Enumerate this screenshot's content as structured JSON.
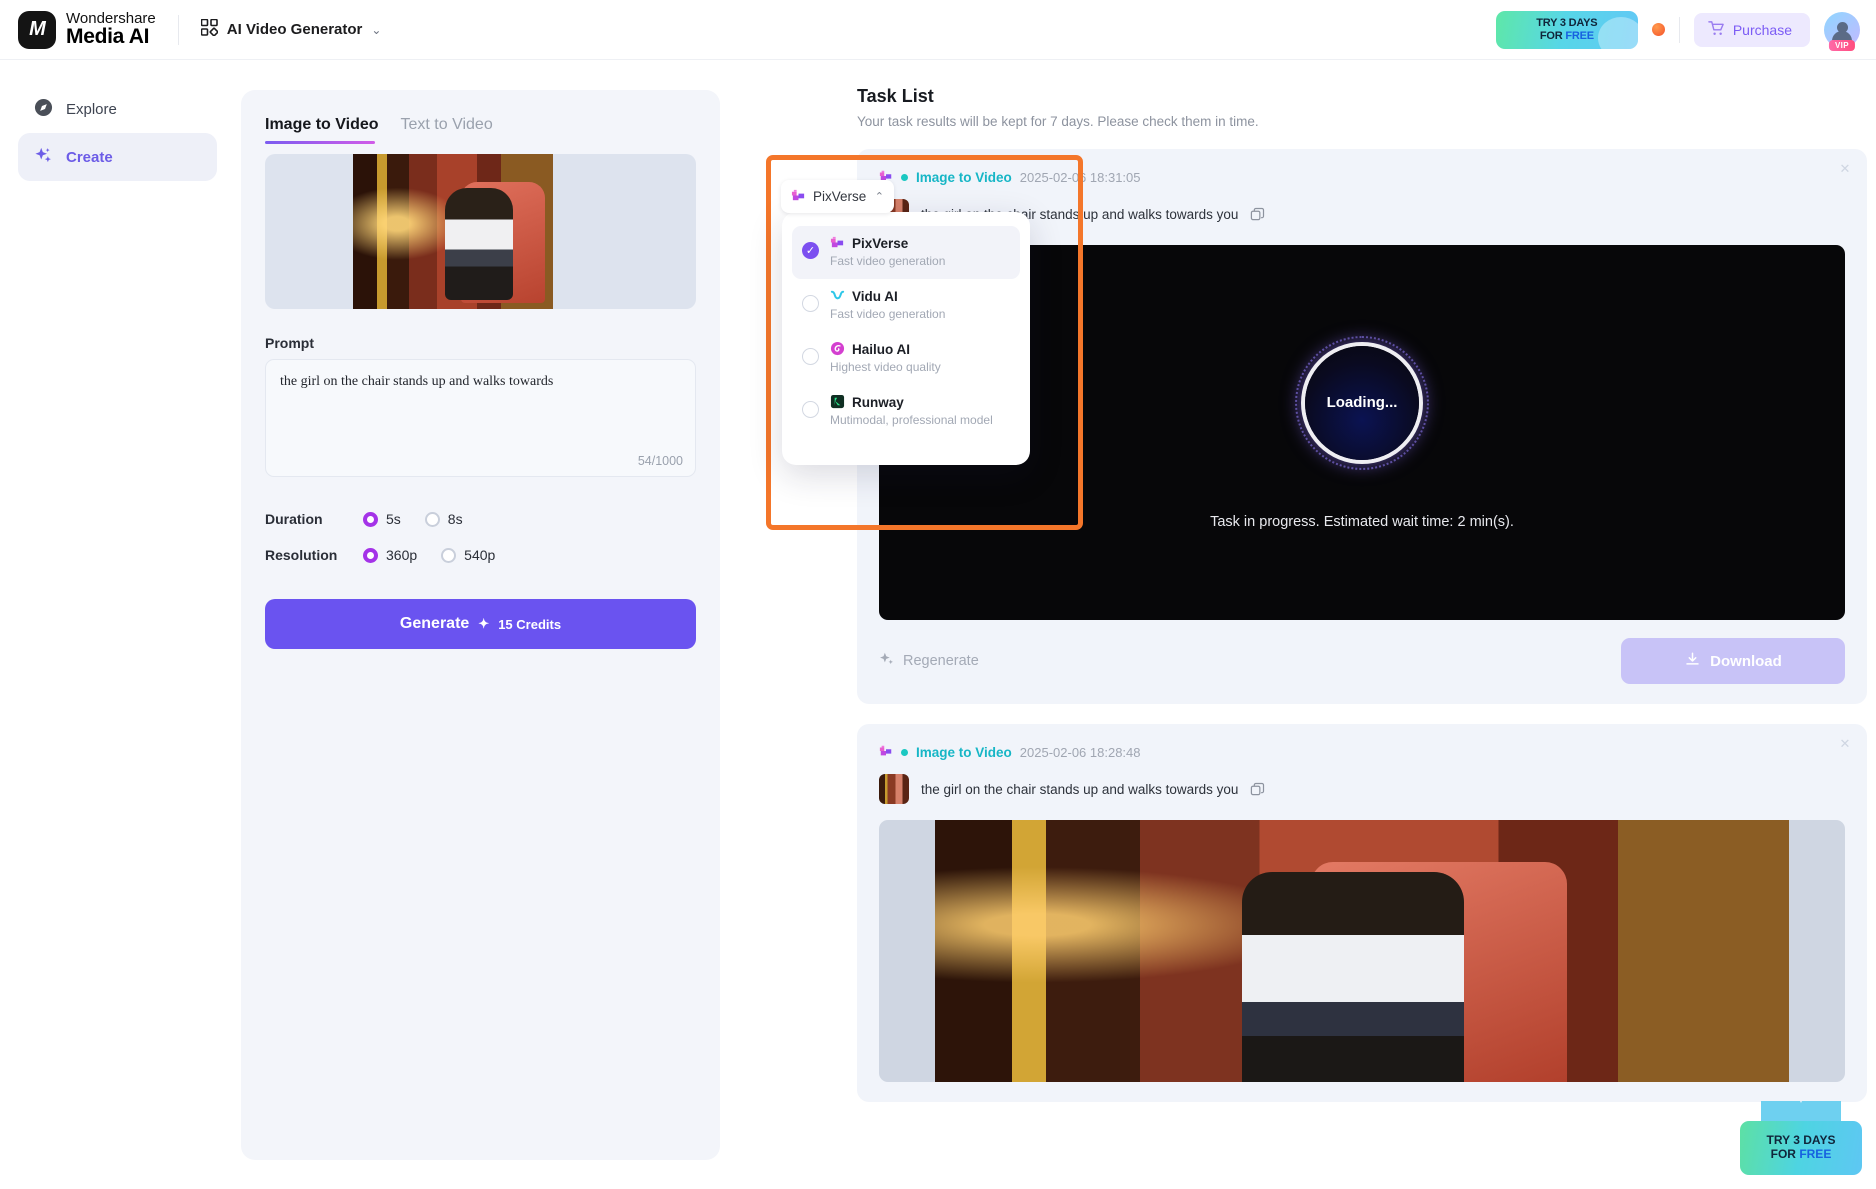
{
  "header": {
    "brand_top": "Wondershare",
    "brand_bottom": "Media AI",
    "brand_mark": "M",
    "app_switcher": "AI Video Generator",
    "chevron": "⌄",
    "promo_line1": "TRY 3 DAYS",
    "promo_line2_pre": "FOR ",
    "promo_line2_free": "FREE",
    "purchase_label": "Purchase",
    "cart_icon": "cart-icon",
    "vip_label": "VIP"
  },
  "sidebar": {
    "items": [
      {
        "label": "Explore",
        "icon": "compass-icon",
        "active": false
      },
      {
        "label": "Create",
        "icon": "sparkle-icon",
        "active": true
      }
    ]
  },
  "generator": {
    "tabs": [
      {
        "label": "Image to Video",
        "active": true
      },
      {
        "label": "Text to Video",
        "active": false
      }
    ],
    "prompt_label": "Prompt",
    "prompt_value": "the girl  on the chair stands up and walks towards",
    "prompt_count": "54/1000",
    "duration": {
      "label": "Duration",
      "options": [
        {
          "label": "5s",
          "selected": true
        },
        {
          "label": "8s",
          "selected": false
        }
      ]
    },
    "resolution": {
      "label": "Resolution",
      "options": [
        {
          "label": "360p",
          "selected": true
        },
        {
          "label": "540p",
          "selected": false
        }
      ]
    },
    "generate_label": "Generate",
    "generate_credits": "15 Credits",
    "generate_sparkle": "✦"
  },
  "model_selector": {
    "current": "PixVerse",
    "chevron_up": "⌃",
    "items": [
      {
        "name": "PixVerse",
        "desc": "Fast video generation",
        "selected": true,
        "icon": "pixverse-icon"
      },
      {
        "name": "Vidu AI",
        "desc": "Fast video generation",
        "selected": false,
        "icon": "vidu-icon"
      },
      {
        "name": "Hailuo AI",
        "desc": "Highest video quality",
        "selected": false,
        "icon": "hailuo-icon"
      },
      {
        "name": "Runway",
        "desc": "Mutimodal, professional model",
        "selected": false,
        "icon": "runway-icon"
      }
    ]
  },
  "task_list": {
    "title": "Task List",
    "subtitle": "Your task results will be kept for 7 days. Please check them in time.",
    "tasks": [
      {
        "type": "Image to Video",
        "timestamp": "2025-02-06 18:31:05",
        "prompt": "the girl on the chair stands up and walks towards you",
        "state": "loading",
        "loading_label": "Loading...",
        "status_text": "Task in progress. Estimated wait time: 2 min(s).",
        "regenerate_label": "Regenerate",
        "download_label": "Download",
        "close_label": "✕"
      },
      {
        "type": "Image to Video",
        "timestamp": "2025-02-06 18:28:48",
        "prompt": "the girl on the chair stands up and walks towards you",
        "state": "done",
        "close_label": "✕"
      }
    ]
  },
  "floating_promo": {
    "line1": "TRY 3 DAYS",
    "line2_pre": "FOR ",
    "line2_free": "FREE"
  },
  "colors": {
    "accent_purple": "#6a53f0",
    "highlight_orange": "#f4762a",
    "teal": "#17b6c6",
    "radio_selected": "#a433e8"
  }
}
